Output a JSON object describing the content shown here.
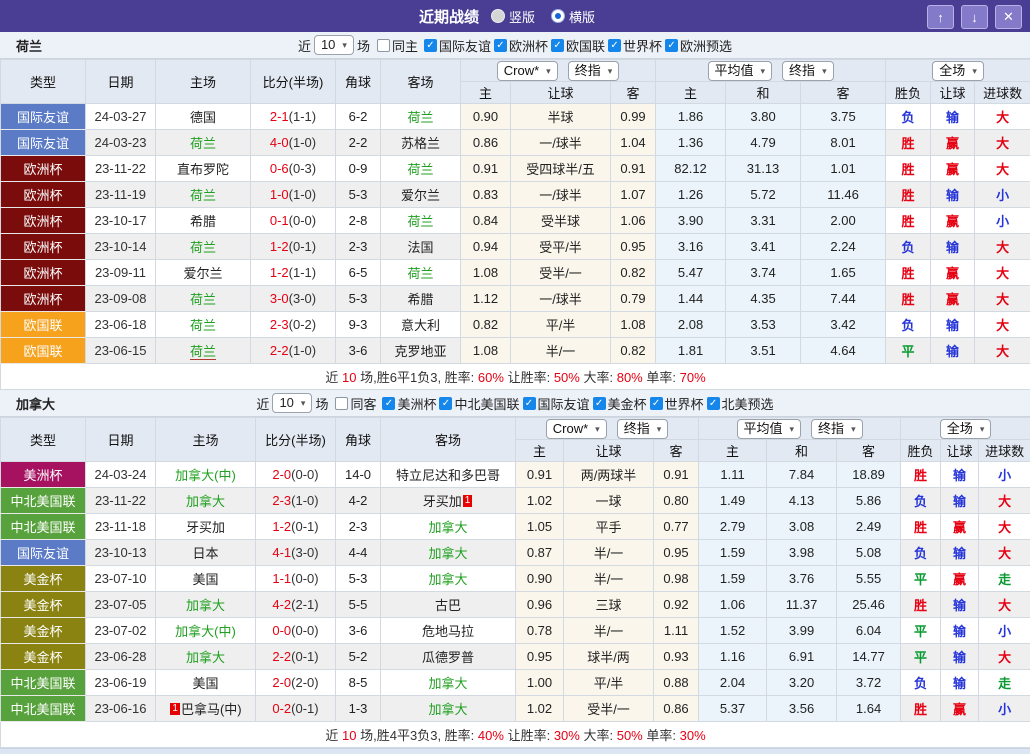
{
  "titlebar": {
    "title": "近期战绩",
    "vertical_label": "竖版",
    "horizontal_label": "横版",
    "selected_layout": "横版",
    "buttons": {
      "up": "↑",
      "down": "↓",
      "close": "✕"
    },
    "bar_color": "#4a3e94"
  },
  "table_header": {
    "type": "类型",
    "date": "日期",
    "home": "主场",
    "score": "比分(半场)",
    "corner": "角球",
    "away": "客场",
    "crow_select": "Crow*",
    "final_select": "终指",
    "avg_select": "平均值",
    "full_select": "全场",
    "sub_home": "主",
    "sub_handicap": "让球",
    "sub_away": "客",
    "sub_home2": "主",
    "sub_draw": "和",
    "sub_away2": "客",
    "sub_wdl": "胜负",
    "sub_handicap2": "让球",
    "sub_goals": "进球数"
  },
  "result_colors": {
    "win": "#e60012",
    "lose": "#2635d9",
    "draw": "#0a9a32"
  },
  "sections": [
    {
      "team": "荷兰",
      "filter": {
        "recent_label": "近",
        "count": "10",
        "matches_label": "场",
        "same_label": "同主",
        "same_checked": false,
        "leagues": [
          {
            "label": "国际友谊",
            "checked": true
          },
          {
            "label": "欧洲杯",
            "checked": true
          },
          {
            "label": "欧国联",
            "checked": true
          },
          {
            "label": "世界杯",
            "checked": true
          },
          {
            "label": "欧洲预选",
            "checked": true
          }
        ]
      },
      "rows": [
        {
          "type": "国际友谊",
          "type_color": "#5b7bc7",
          "date": "24-03-27",
          "home": "德国",
          "home_green": false,
          "home_underline": false,
          "home_card_before": "",
          "score": "2-1",
          "half": "(1-1)",
          "corner": "6-2",
          "away": "荷兰",
          "away_green": true,
          "away_card_after": "",
          "crow_home": "0.90",
          "handicap": "半球",
          "crow_away": "0.99",
          "avg_home": "1.86",
          "avg_draw": "3.80",
          "avg_away": "3.75",
          "r1": "负",
          "r1c": "blue",
          "r2": "输",
          "r2c": "blue",
          "r3": "大",
          "r3c": "red"
        },
        {
          "type": "国际友谊",
          "type_color": "#5b7bc7",
          "date": "24-03-23",
          "home": "荷兰",
          "home_green": true,
          "home_underline": false,
          "home_card_before": "",
          "score": "4-0",
          "half": "(1-0)",
          "corner": "2-2",
          "away": "苏格兰",
          "away_green": false,
          "away_card_after": "",
          "crow_home": "0.86",
          "handicap": "一/球半",
          "crow_away": "1.04",
          "avg_home": "1.36",
          "avg_draw": "4.79",
          "avg_away": "8.01",
          "r1": "胜",
          "r1c": "red",
          "r2": "赢",
          "r2c": "red",
          "r3": "大",
          "r3c": "red"
        },
        {
          "type": "欧洲杯",
          "type_color": "#7b0c0c",
          "date": "23-11-22",
          "home": "直布罗陀",
          "home_green": false,
          "home_underline": false,
          "home_card_before": "",
          "score": "0-6",
          "half": "(0-3)",
          "corner": "0-9",
          "away": "荷兰",
          "away_green": true,
          "away_card_after": "",
          "crow_home": "0.91",
          "handicap": "受四球半/五",
          "crow_away": "0.91",
          "avg_home": "82.12",
          "avg_draw": "31.13",
          "avg_away": "1.01",
          "r1": "胜",
          "r1c": "red",
          "r2": "赢",
          "r2c": "red",
          "r3": "大",
          "r3c": "red"
        },
        {
          "type": "欧洲杯",
          "type_color": "#7b0c0c",
          "date": "23-11-19",
          "home": "荷兰",
          "home_green": true,
          "home_underline": false,
          "home_card_before": "",
          "score": "1-0",
          "half": "(1-0)",
          "corner": "5-3",
          "away": "爱尔兰",
          "away_green": false,
          "away_card_after": "",
          "crow_home": "0.83",
          "handicap": "一/球半",
          "crow_away": "1.07",
          "avg_home": "1.26",
          "avg_draw": "5.72",
          "avg_away": "11.46",
          "r1": "胜",
          "r1c": "red",
          "r2": "输",
          "r2c": "blue",
          "r3": "小",
          "r3c": "blue"
        },
        {
          "type": "欧洲杯",
          "type_color": "#7b0c0c",
          "date": "23-10-17",
          "home": "希腊",
          "home_green": false,
          "home_underline": false,
          "home_card_before": "",
          "score": "0-1",
          "half": "(0-0)",
          "corner": "2-8",
          "away": "荷兰",
          "away_green": true,
          "away_card_after": "",
          "crow_home": "0.84",
          "handicap": "受半球",
          "crow_away": "1.06",
          "avg_home": "3.90",
          "avg_draw": "3.31",
          "avg_away": "2.00",
          "r1": "胜",
          "r1c": "red",
          "r2": "赢",
          "r2c": "red",
          "r3": "小",
          "r3c": "blue"
        },
        {
          "type": "欧洲杯",
          "type_color": "#7b0c0c",
          "date": "23-10-14",
          "home": "荷兰",
          "home_green": true,
          "home_underline": false,
          "home_card_before": "",
          "score": "1-2",
          "half": "(0-1)",
          "corner": "2-3",
          "away": "法国",
          "away_green": false,
          "away_card_after": "",
          "crow_home": "0.94",
          "handicap": "受平/半",
          "crow_away": "0.95",
          "avg_home": "3.16",
          "avg_draw": "3.41",
          "avg_away": "2.24",
          "r1": "负",
          "r1c": "blue",
          "r2": "输",
          "r2c": "blue",
          "r3": "大",
          "r3c": "red"
        },
        {
          "type": "欧洲杯",
          "type_color": "#7b0c0c",
          "date": "23-09-11",
          "home": "爱尔兰",
          "home_green": false,
          "home_underline": false,
          "home_card_before": "",
          "score": "1-2",
          "half": "(1-1)",
          "corner": "6-5",
          "away": "荷兰",
          "away_green": true,
          "away_card_after": "",
          "crow_home": "1.08",
          "handicap": "受半/一",
          "crow_away": "0.82",
          "avg_home": "5.47",
          "avg_draw": "3.74",
          "avg_away": "1.65",
          "r1": "胜",
          "r1c": "red",
          "r2": "赢",
          "r2c": "red",
          "r3": "大",
          "r3c": "red"
        },
        {
          "type": "欧洲杯",
          "type_color": "#7b0c0c",
          "date": "23-09-08",
          "home": "荷兰",
          "home_green": true,
          "home_underline": false,
          "home_card_before": "",
          "score": "3-0",
          "half": "(3-0)",
          "corner": "5-3",
          "away": "希腊",
          "away_green": false,
          "away_card_after": "",
          "crow_home": "1.12",
          "handicap": "一/球半",
          "crow_away": "0.79",
          "avg_home": "1.44",
          "avg_draw": "4.35",
          "avg_away": "7.44",
          "r1": "胜",
          "r1c": "red",
          "r2": "赢",
          "r2c": "red",
          "r3": "大",
          "r3c": "red"
        },
        {
          "type": "欧国联",
          "type_color": "#f6a21d",
          "date": "23-06-18",
          "home": "荷兰",
          "home_green": true,
          "home_underline": false,
          "home_card_before": "",
          "score": "2-3",
          "half": "(0-2)",
          "corner": "9-3",
          "away": "意大利",
          "away_green": false,
          "away_card_after": "",
          "crow_home": "0.82",
          "handicap": "平/半",
          "crow_away": "1.08",
          "avg_home": "2.08",
          "avg_draw": "3.53",
          "avg_away": "3.42",
          "r1": "负",
          "r1c": "blue",
          "r2": "输",
          "r2c": "blue",
          "r3": "大",
          "r3c": "red"
        },
        {
          "type": "欧国联",
          "type_color": "#f6a21d",
          "date": "23-06-15",
          "home": "荷兰",
          "home_green": true,
          "home_underline": true,
          "home_card_before": "",
          "score": "2-2",
          "half": "(1-0)",
          "corner": "3-6",
          "away": "克罗地亚",
          "away_green": false,
          "away_card_after": "",
          "crow_home": "1.08",
          "handicap": "半/一",
          "crow_away": "0.82",
          "avg_home": "1.81",
          "avg_draw": "3.51",
          "avg_away": "4.64",
          "r1": "平",
          "r1c": "green",
          "r2": "输",
          "r2c": "blue",
          "r3": "大",
          "r3c": "red"
        }
      ],
      "summary": [
        {
          "t": "近",
          "c": ""
        },
        {
          "t": "10",
          "c": "red"
        },
        {
          "t": "场,胜6平1负3, 胜率:",
          "c": ""
        },
        {
          "t": "60%",
          "c": "red"
        },
        {
          "t": " 让胜率:",
          "c": ""
        },
        {
          "t": "50%",
          "c": "red"
        },
        {
          "t": " 大率:",
          "c": ""
        },
        {
          "t": "80%",
          "c": "red"
        },
        {
          "t": " 单率:",
          "c": ""
        },
        {
          "t": "70%",
          "c": "red"
        }
      ]
    },
    {
      "team": "加拿大",
      "filter": {
        "recent_label": "近",
        "count": "10",
        "matches_label": "场",
        "same_label": "同客",
        "same_checked": false,
        "leagues": [
          {
            "label": "美洲杯",
            "checked": true
          },
          {
            "label": "中北美国联",
            "checked": true
          },
          {
            "label": "国际友谊",
            "checked": true
          },
          {
            "label": "美金杯",
            "checked": true
          },
          {
            "label": "世界杯",
            "checked": true
          },
          {
            "label": "北美预选",
            "checked": true
          }
        ]
      },
      "rows": [
        {
          "type": "美洲杯",
          "type_color": "#a61160",
          "date": "24-03-24",
          "home": "加拿大(中)",
          "home_green": true,
          "home_underline": false,
          "home_card_before": "",
          "score": "2-0",
          "half": "(0-0)",
          "corner": "14-0",
          "away": "特立尼达和多巴哥",
          "away_green": false,
          "away_card_after": "",
          "crow_home": "0.91",
          "handicap": "两/两球半",
          "crow_away": "0.91",
          "avg_home": "1.11",
          "avg_draw": "7.84",
          "avg_away": "18.89",
          "r1": "胜",
          "r1c": "red",
          "r2": "输",
          "r2c": "blue",
          "r3": "小",
          "r3c": "blue"
        },
        {
          "type": "中北美国联",
          "type_color": "#57a23c",
          "date": "23-11-22",
          "home": "加拿大",
          "home_green": true,
          "home_underline": false,
          "home_card_before": "",
          "score": "2-3",
          "half": "(1-0)",
          "corner": "4-2",
          "away": "牙买加",
          "away_green": false,
          "away_card_after": "1",
          "crow_home": "1.02",
          "handicap": "一球",
          "crow_away": "0.80",
          "avg_home": "1.49",
          "avg_draw": "4.13",
          "avg_away": "5.86",
          "r1": "负",
          "r1c": "blue",
          "r2": "输",
          "r2c": "blue",
          "r3": "大",
          "r3c": "red"
        },
        {
          "type": "中北美国联",
          "type_color": "#57a23c",
          "date": "23-11-18",
          "home": "牙买加",
          "home_green": false,
          "home_underline": false,
          "home_card_before": "",
          "score": "1-2",
          "half": "(0-1)",
          "corner": "2-3",
          "away": "加拿大",
          "away_green": true,
          "away_card_after": "",
          "crow_home": "1.05",
          "handicap": "平手",
          "crow_away": "0.77",
          "avg_home": "2.79",
          "avg_draw": "3.08",
          "avg_away": "2.49",
          "r1": "胜",
          "r1c": "red",
          "r2": "赢",
          "r2c": "red",
          "r3": "大",
          "r3c": "red"
        },
        {
          "type": "国际友谊",
          "type_color": "#5b7bc7",
          "date": "23-10-13",
          "home": "日本",
          "home_green": false,
          "home_underline": false,
          "home_card_before": "",
          "score": "4-1",
          "half": "(3-0)",
          "corner": "4-4",
          "away": "加拿大",
          "away_green": true,
          "away_card_after": "",
          "crow_home": "0.87",
          "handicap": "半/一",
          "crow_away": "0.95",
          "avg_home": "1.59",
          "avg_draw": "3.98",
          "avg_away": "5.08",
          "r1": "负",
          "r1c": "blue",
          "r2": "输",
          "r2c": "blue",
          "r3": "大",
          "r3c": "red"
        },
        {
          "type": "美金杯",
          "type_color": "#8a8312",
          "date": "23-07-10",
          "home": "美国",
          "home_green": false,
          "home_underline": false,
          "home_card_before": "",
          "score": "1-1",
          "half": "(0-0)",
          "corner": "5-3",
          "away": "加拿大",
          "away_green": true,
          "away_card_after": "",
          "crow_home": "0.90",
          "handicap": "半/一",
          "crow_away": "0.98",
          "avg_home": "1.59",
          "avg_draw": "3.76",
          "avg_away": "5.55",
          "r1": "平",
          "r1c": "green",
          "r2": "赢",
          "r2c": "red",
          "r3": "走",
          "r3c": "green"
        },
        {
          "type": "美金杯",
          "type_color": "#8a8312",
          "date": "23-07-05",
          "home": "加拿大",
          "home_green": true,
          "home_underline": false,
          "home_card_before": "",
          "score": "4-2",
          "half": "(2-1)",
          "corner": "5-5",
          "away": "古巴",
          "away_green": false,
          "away_card_after": "",
          "crow_home": "0.96",
          "handicap": "三球",
          "crow_away": "0.92",
          "avg_home": "1.06",
          "avg_draw": "11.37",
          "avg_away": "25.46",
          "r1": "胜",
          "r1c": "red",
          "r2": "输",
          "r2c": "blue",
          "r3": "大",
          "r3c": "red"
        },
        {
          "type": "美金杯",
          "type_color": "#8a8312",
          "date": "23-07-02",
          "home": "加拿大(中)",
          "home_green": true,
          "home_underline": false,
          "home_card_before": "",
          "score": "0-0",
          "half": "(0-0)",
          "corner": "3-6",
          "away": "危地马拉",
          "away_green": false,
          "away_card_after": "",
          "crow_home": "0.78",
          "handicap": "半/一",
          "crow_away": "1.11",
          "avg_home": "1.52",
          "avg_draw": "3.99",
          "avg_away": "6.04",
          "r1": "平",
          "r1c": "green",
          "r2": "输",
          "r2c": "blue",
          "r3": "小",
          "r3c": "blue"
        },
        {
          "type": "美金杯",
          "type_color": "#8a8312",
          "date": "23-06-28",
          "home": "加拿大",
          "home_green": true,
          "home_underline": false,
          "home_card_before": "",
          "score": "2-2",
          "half": "(0-1)",
          "corner": "5-2",
          "away": "瓜德罗普",
          "away_green": false,
          "away_card_after": "",
          "crow_home": "0.95",
          "handicap": "球半/两",
          "crow_away": "0.93",
          "avg_home": "1.16",
          "avg_draw": "6.91",
          "avg_away": "14.77",
          "r1": "平",
          "r1c": "green",
          "r2": "输",
          "r2c": "blue",
          "r3": "大",
          "r3c": "red"
        },
        {
          "type": "中北美国联",
          "type_color": "#57a23c",
          "date": "23-06-19",
          "home": "美国",
          "home_green": false,
          "home_underline": false,
          "home_card_before": "",
          "score": "2-0",
          "half": "(2-0)",
          "corner": "8-5",
          "away": "加拿大",
          "away_green": true,
          "away_card_after": "",
          "crow_home": "1.00",
          "handicap": "平/半",
          "crow_away": "0.88",
          "avg_home": "2.04",
          "avg_draw": "3.20",
          "avg_away": "3.72",
          "r1": "负",
          "r1c": "blue",
          "r2": "输",
          "r2c": "blue",
          "r3": "走",
          "r3c": "green"
        },
        {
          "type": "中北美国联",
          "type_color": "#57a23c",
          "date": "23-06-16",
          "home": "巴拿马(中)",
          "home_green": false,
          "home_underline": false,
          "home_card_before": "1",
          "score": "0-2",
          "half": "(0-1)",
          "corner": "1-3",
          "away": "加拿大",
          "away_green": true,
          "away_card_after": "",
          "crow_home": "1.02",
          "handicap": "受半/一",
          "crow_away": "0.86",
          "avg_home": "5.37",
          "avg_draw": "3.56",
          "avg_away": "1.64",
          "r1": "胜",
          "r1c": "red",
          "r2": "赢",
          "r2c": "red",
          "r3": "小",
          "r3c": "blue"
        }
      ],
      "summary": [
        {
          "t": "近",
          "c": ""
        },
        {
          "t": "10",
          "c": "red"
        },
        {
          "t": "场,胜4平3负3, 胜率:",
          "c": ""
        },
        {
          "t": "40%",
          "c": "red"
        },
        {
          "t": " 让胜率:",
          "c": ""
        },
        {
          "t": "30%",
          "c": "red"
        },
        {
          "t": " 大率:",
          "c": ""
        },
        {
          "t": "50%",
          "c": "red"
        },
        {
          "t": " 单率:",
          "c": ""
        },
        {
          "t": "30%",
          "c": "red"
        }
      ]
    }
  ]
}
